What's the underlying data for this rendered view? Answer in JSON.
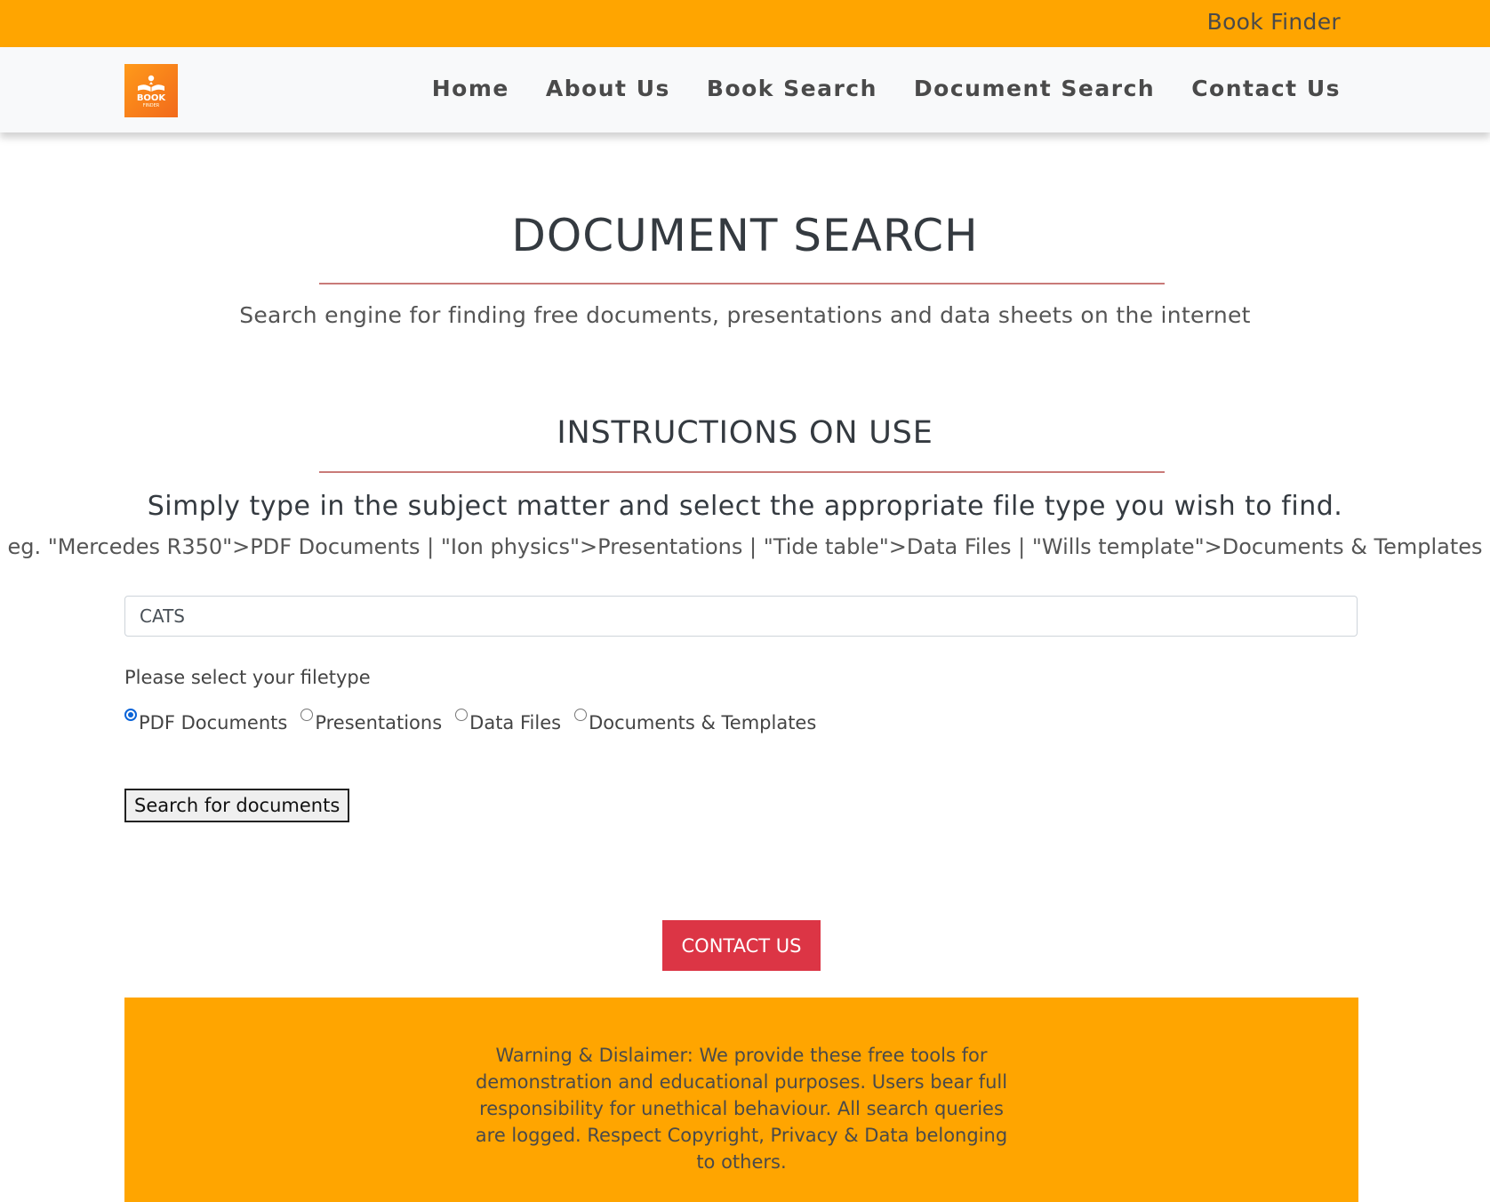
{
  "header": {
    "brand": "Book Finder"
  },
  "logo": {
    "text": "BOOK",
    "subtext": "FINDER"
  },
  "nav": {
    "items": [
      {
        "label": "Home"
      },
      {
        "label": "About Us"
      },
      {
        "label": "Book Search"
      },
      {
        "label": "Document Search"
      },
      {
        "label": "Contact Us"
      }
    ]
  },
  "page": {
    "title": "DOCUMENT SEARCH",
    "subtitle": "Search engine for finding free documents, presentations and data sheets on the internet",
    "instructions_title": "INSTRUCTIONS ON USE",
    "instruction": "Simply type in the subject matter and select the appropriate file type you wish to find.",
    "example": "eg. \"Mercedes R350\">PDF Documents | \"Ion physics\">Presentations | \"Tide table\">Data Files | \"Wills template\">Documents & Templates"
  },
  "search": {
    "value": "CATS"
  },
  "filetype": {
    "label": "Please select your filetype",
    "options": [
      {
        "label": "PDF Documents",
        "checked": true
      },
      {
        "label": "Presentations",
        "checked": false
      },
      {
        "label": "Data Files",
        "checked": false
      },
      {
        "label": "Documents & Templates",
        "checked": false
      }
    ]
  },
  "buttons": {
    "search": "Search for documents",
    "contact": "CONTACT US"
  },
  "footer": {
    "disclaimer": "Warning & Dislaimer: We provide these free tools for demonstration and educational purposes. Users bear full responsibility for unethical behaviour. All search queries are logged. Respect Copyright, Privacy & Data belonging to others."
  },
  "colors": {
    "accent": "#ffa500",
    "contact_button": "#dc3545",
    "divider": "#c97a78",
    "radio_selected": "#0a64d8"
  }
}
